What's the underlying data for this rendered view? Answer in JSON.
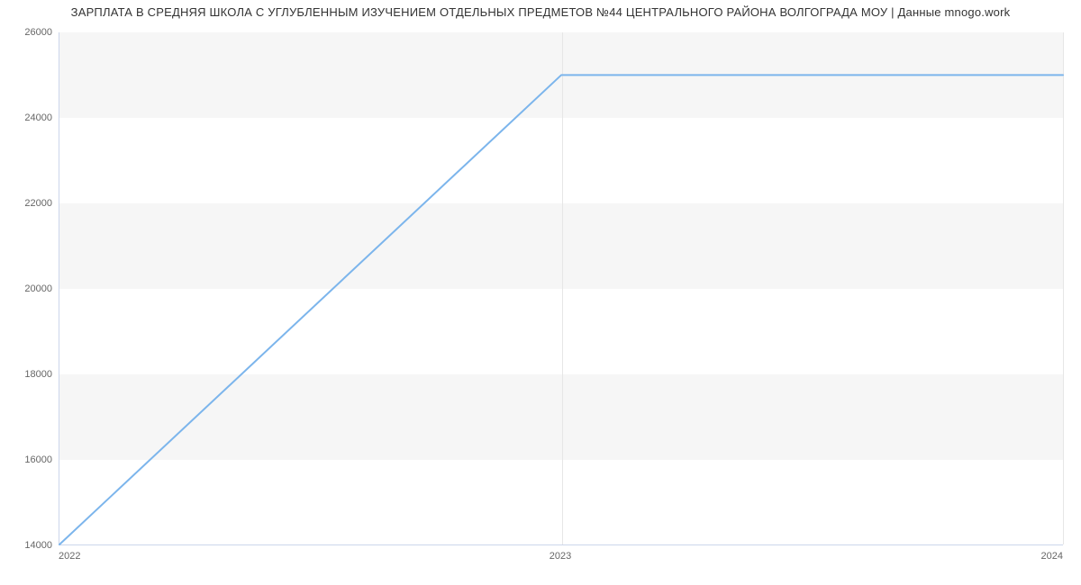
{
  "chart_data": {
    "type": "line",
    "title": "ЗАРПЛАТА В СРЕДНЯЯ ШКОЛА С УГЛУБЛЕННЫМ ИЗУЧЕНИЕМ ОТДЕЛЬНЫХ ПРЕДМЕТОВ №44 ЦЕНТРАЛЬНОГО РАЙОНА ВОЛГОГРАДА МОУ | Данные mnogo.work",
    "x": [
      2022,
      2023,
      2024
    ],
    "values": [
      14000,
      25000,
      25000
    ],
    "xlabel": "",
    "ylabel": "",
    "ylim": [
      14000,
      26000
    ],
    "yticks": [
      14000,
      16000,
      18000,
      20000,
      22000,
      24000,
      26000
    ],
    "xticks": [
      2022,
      2023,
      2024
    ],
    "line_color": "#7cb5ec"
  }
}
